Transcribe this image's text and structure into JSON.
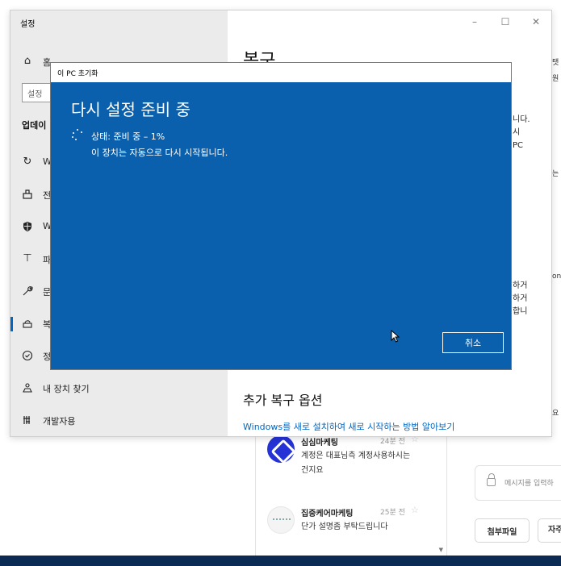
{
  "background_chat": {
    "items": [
      {
        "name": "심심마케팅",
        "time": "24분 전",
        "star": "☆",
        "message": "계정은 대표님측 계정사용하시는건지요"
      },
      {
        "name": "집중케어마케팅",
        "time": "25분 전",
        "star": "☆",
        "message": "단가 설명좀 부탁드립니다"
      }
    ],
    "message_placeholder": "메시지를 입력하",
    "attach_label": "첨부파일",
    "second_button_label": "자주",
    "peek_texts": [
      "탯",
      "원",
      "는",
      "on",
      "요"
    ]
  },
  "settings": {
    "window_title": "설정",
    "controls": {
      "minimize": "–",
      "maximize": "☐",
      "close": "✕"
    },
    "search_placeholder": "설정",
    "section_label": "업데이",
    "nav": [
      {
        "label": "홈",
        "icon": "home-icon"
      },
      {
        "label": "W",
        "icon": "sync-icon"
      },
      {
        "label": "전",
        "icon": "delivery-icon"
      },
      {
        "label": "W",
        "icon": "shield-icon"
      },
      {
        "label": "파",
        "icon": "upload-icon"
      },
      {
        "label": "문",
        "icon": "wrench-icon"
      },
      {
        "label": "복",
        "icon": "recovery-icon"
      },
      {
        "label": "정",
        "icon": "check-circle-icon"
      },
      {
        "label": "내 장치 찾기",
        "icon": "find-device-icon"
      },
      {
        "label": "개발자용",
        "icon": "developer-icon"
      }
    ],
    "content_heading": "복구",
    "side_text_top": [
      "니다.",
      "시",
      "PC"
    ],
    "side_text_mid": [
      "하거",
      "하거",
      "합니"
    ],
    "extra_heading": "추가 복구 옵션",
    "extra_link": "Windows를 새로 설치하여 새로 시작하는 방법 알아보기"
  },
  "dialog": {
    "title": "이 PC 초기화",
    "heading": "다시 설정 준비 중",
    "status": "상태: 준비 중 – 1%",
    "restart_note": "이 장치는 자동으로 다시 시작됩니다.",
    "cancel_label": "취소"
  },
  "colors": {
    "dialog_blue": "#0a60ac",
    "accent": "#0067c0",
    "taskbar": "#0b2a54"
  }
}
